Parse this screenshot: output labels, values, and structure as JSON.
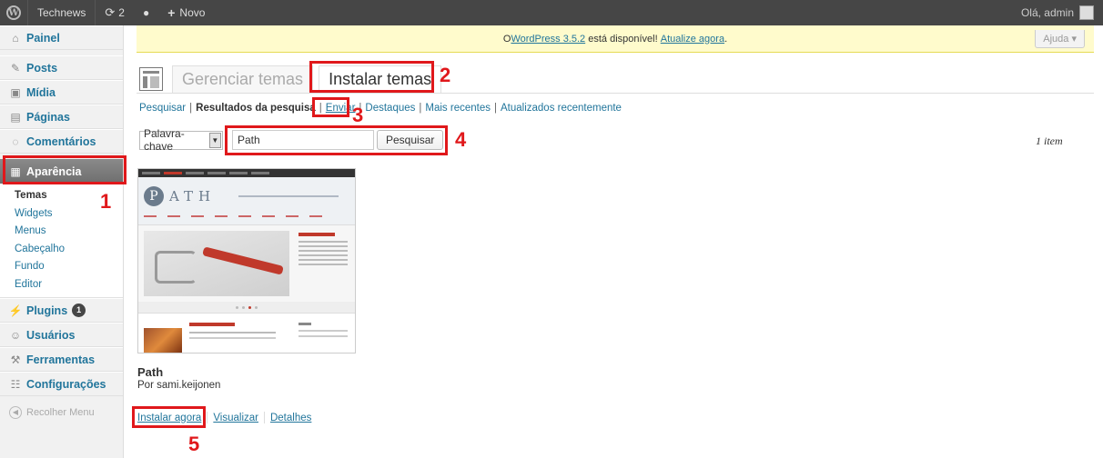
{
  "adminbar": {
    "site_name": "Technews",
    "updates_count": "2",
    "new_label": "Novo",
    "greeting": "Olá, admin"
  },
  "notice": {
    "prefix": "O ",
    "link1": "WordPress 3.5.2",
    "middle": " está disponível! ",
    "link2": "Atualize agora",
    "suffix": ".",
    "help": "Ajuda ▾"
  },
  "sidebar": {
    "items": [
      {
        "label": "Painel",
        "icon": "home-icon"
      },
      {
        "label": "Posts",
        "icon": "pin-icon"
      },
      {
        "label": "Mídia",
        "icon": "media-icon"
      },
      {
        "label": "Páginas",
        "icon": "pages-icon"
      },
      {
        "label": "Comentários",
        "icon": "comments-icon"
      },
      {
        "label": "Aparência",
        "icon": "appearance-icon"
      },
      {
        "label": "Plugins",
        "icon": "plugins-icon",
        "badge": "1"
      },
      {
        "label": "Usuários",
        "icon": "users-icon"
      },
      {
        "label": "Ferramentas",
        "icon": "tools-icon"
      },
      {
        "label": "Configurações",
        "icon": "settings-icon"
      }
    ],
    "submenu": [
      "Temas",
      "Widgets",
      "Menus",
      "Cabeçalho",
      "Fundo",
      "Editor"
    ],
    "collapse": "Recolher Menu"
  },
  "tabs": [
    "Gerenciar temas",
    "Instalar temas"
  ],
  "subnav": {
    "search": "Pesquisar",
    "results": "Resultados da pesquisa",
    "upload": "Enviar",
    "featured": "Destaques",
    "newest": "Mais recentes",
    "updated": "Atualizados recentemente"
  },
  "search": {
    "type": "Palavra-chave",
    "value": "Path",
    "button": "Pesquisar",
    "count": "1 item"
  },
  "theme": {
    "name": "Path",
    "author": "Por sami.keijonen",
    "install": "Instalar agora",
    "preview": "Visualizar",
    "details": "Detalhes",
    "shot_logo_initial": "P",
    "shot_logo_rest": "ATH"
  },
  "annotations": [
    "1",
    "2",
    "3",
    "4",
    "5"
  ],
  "colors": {
    "accent_red": "#e0181b",
    "link_blue": "#21759b",
    "adminbar": "#464646"
  }
}
